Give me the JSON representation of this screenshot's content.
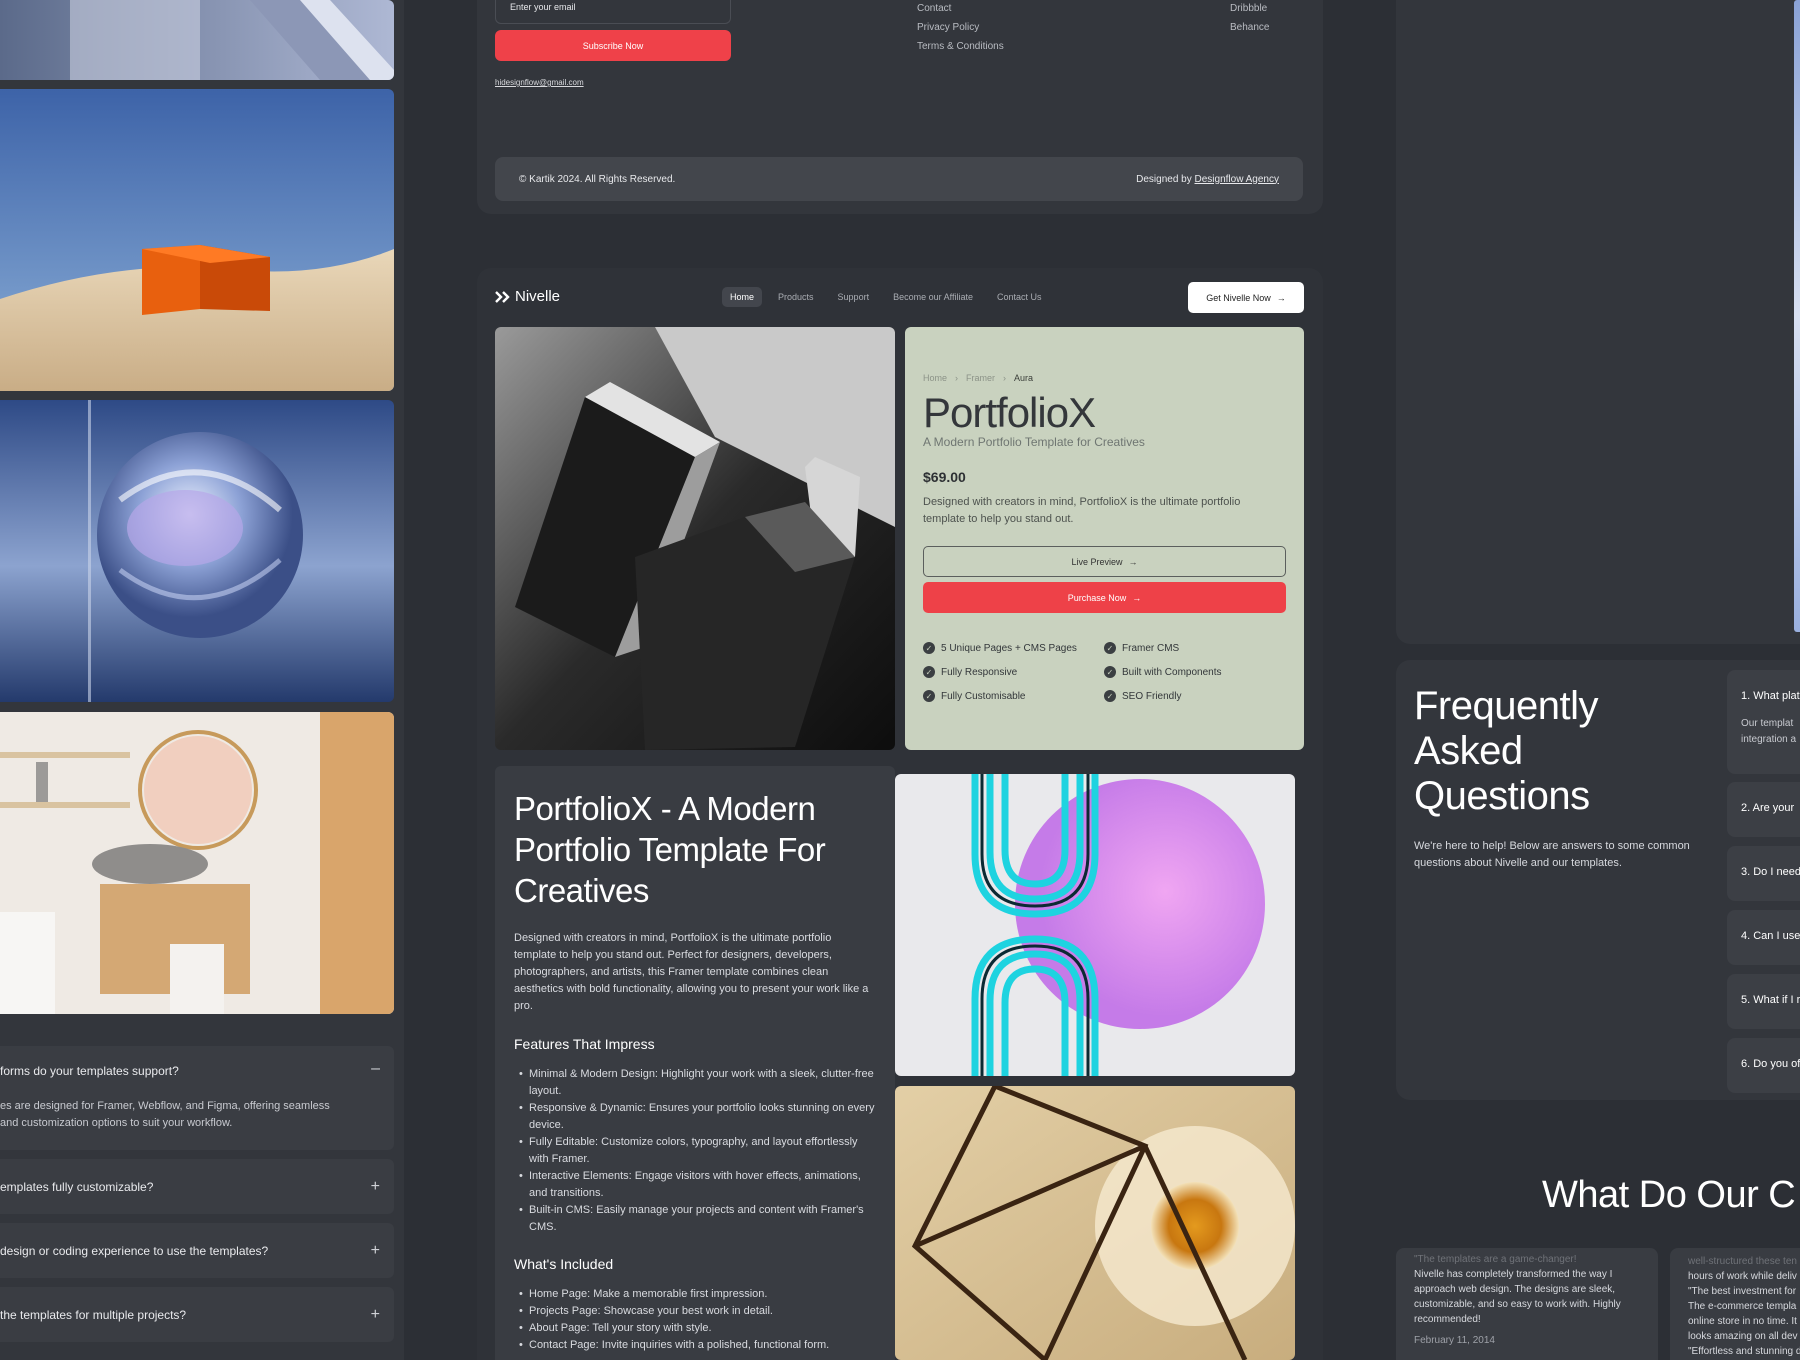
{
  "left_column": {
    "faq_items": [
      {
        "question": "forms do your templates support?",
        "answer": "es are designed for Framer, Webflow, and Figma, offering seamless and customization options to suit your workflow.",
        "toggle": "–"
      },
      {
        "question": "emplates fully customizable?",
        "toggle": "+"
      },
      {
        "question": "design or coding experience to use the templates?",
        "toggle": "+"
      },
      {
        "question": "the templates for multiple projects?",
        "toggle": "+"
      }
    ]
  },
  "footer": {
    "email_placeholder": "Enter your email",
    "subscribe_label": "Subscribe Now",
    "email_link": "hidesignflow@gmail.com",
    "links_col1": [
      "Contact",
      "Privacy Policy",
      "Terms & Conditions"
    ],
    "links_col2": [
      "Dribbble",
      "Behance"
    ],
    "copyright": "© Kartik 2024. All Rights Reserved.",
    "designed_by_prefix": "Designed by ",
    "designed_by_link": "Designflow Agency"
  },
  "product_page": {
    "logo": "Nivelle",
    "nav": [
      "Home",
      "Products",
      "Support",
      "Become our Affiliate",
      "Contact Us"
    ],
    "nav_active": "Home",
    "cta": "Get Nivelle Now",
    "breadcrumb": [
      "Home",
      "Framer",
      "Aura"
    ],
    "title": "PortfolioX",
    "subtitle": "A Modern Portfolio Template for Creatives",
    "price": "$69.00",
    "description": "Designed with creators in mind, PortfolioX is the ultimate portfolio template to help you stand out.",
    "live_preview": "Live Preview",
    "purchase": "Purchase Now",
    "features_left": [
      "5 Unique Pages + CMS Pages",
      "Fully Responsive",
      "Fully Customisable"
    ],
    "features_right": [
      "Framer CMS",
      "Built with Components",
      "SEO Friendly"
    ],
    "detail_title": "PortfolioX - A Modern Portfolio Template For Creatives",
    "detail_body": "Designed with creators in mind, PortfolioX is the ultimate portfolio template to help you stand out. Perfect for designers, developers, photographers, and artists, this Framer template combines clean aesthetics with bold functionality, allowing you to present your work like a pro.",
    "features_heading": "Features That Impress",
    "features_list": [
      "Minimal & Modern Design: Highlight your work with a sleek, clutter-free layout.",
      "Responsive & Dynamic: Ensures your portfolio looks stunning on every device.",
      "Fully Editable: Customize colors, typography, and layout effortlessly with Framer.",
      "Interactive Elements: Engage visitors with hover effects, animations, and transitions.",
      "Built-in CMS: Easily manage your projects and content with Framer's CMS."
    ],
    "included_heading": "What's Included",
    "included_list": [
      "Home Page: Make a memorable first impression.",
      "Projects Page: Showcase your best work in detail.",
      "About Page: Tell your story with style.",
      "Contact Page: Invite inquiries with a polished, functional form."
    ]
  },
  "faq_panel": {
    "title": "Frequently Asked Questions",
    "subtitle": "We're here to help! Below are answers to some common questions about Nivelle and our templates.",
    "items": [
      "1. What plat",
      "2. Are your",
      "3. Do I need",
      "4. Can I use",
      "5. What if I r",
      "6. Do you of"
    ],
    "first_answer": "Our templat integration a"
  },
  "testimonials": {
    "heading": "What Do Our C",
    "card1_quote_faded": "\"The templates are a game-changer!",
    "card1_text": "Nivelle has completely transformed the way I approach web design. The designs are sleek, customizable, and so easy to work with. Highly recommended!",
    "card1_date": "February 11, 2014",
    "card2_lines": [
      "well-structured these ten",
      "hours of work while deliv",
      "\"The best investment for",
      "The e-commerce templa",
      "online store in no time. It",
      "looks amazing on all dev",
      "\"Effortless and stunning d"
    ]
  },
  "colors": {
    "background": "#2c2f35",
    "panel": "#33363c",
    "accent_red": "#ef4149",
    "card_sage": "#c9d2bf"
  }
}
